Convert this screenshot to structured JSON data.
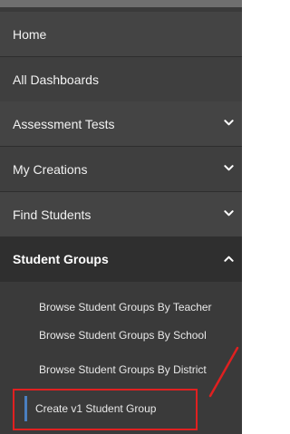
{
  "sidebar": {
    "items": [
      {
        "label": "Home"
      },
      {
        "label": "All Dashboards"
      },
      {
        "label": "Assessment Tests"
      },
      {
        "label": "My Creations"
      },
      {
        "label": "Find Students"
      }
    ],
    "section": {
      "label": "Student Groups",
      "subitems": [
        {
          "label": "Browse Student Groups By Teacher"
        },
        {
          "label": "Browse Student Groups By School"
        },
        {
          "label": "Browse Student Groups By District"
        },
        {
          "label": "Create v1 Student Group"
        }
      ]
    }
  },
  "colors": {
    "sidebar_bg": "#3a3a3a",
    "active_marker": "#4a7fc0",
    "highlight": "#e02020"
  },
  "icons": {
    "expand": "chevron-down-icon",
    "collapse": "chevron-up-icon"
  }
}
